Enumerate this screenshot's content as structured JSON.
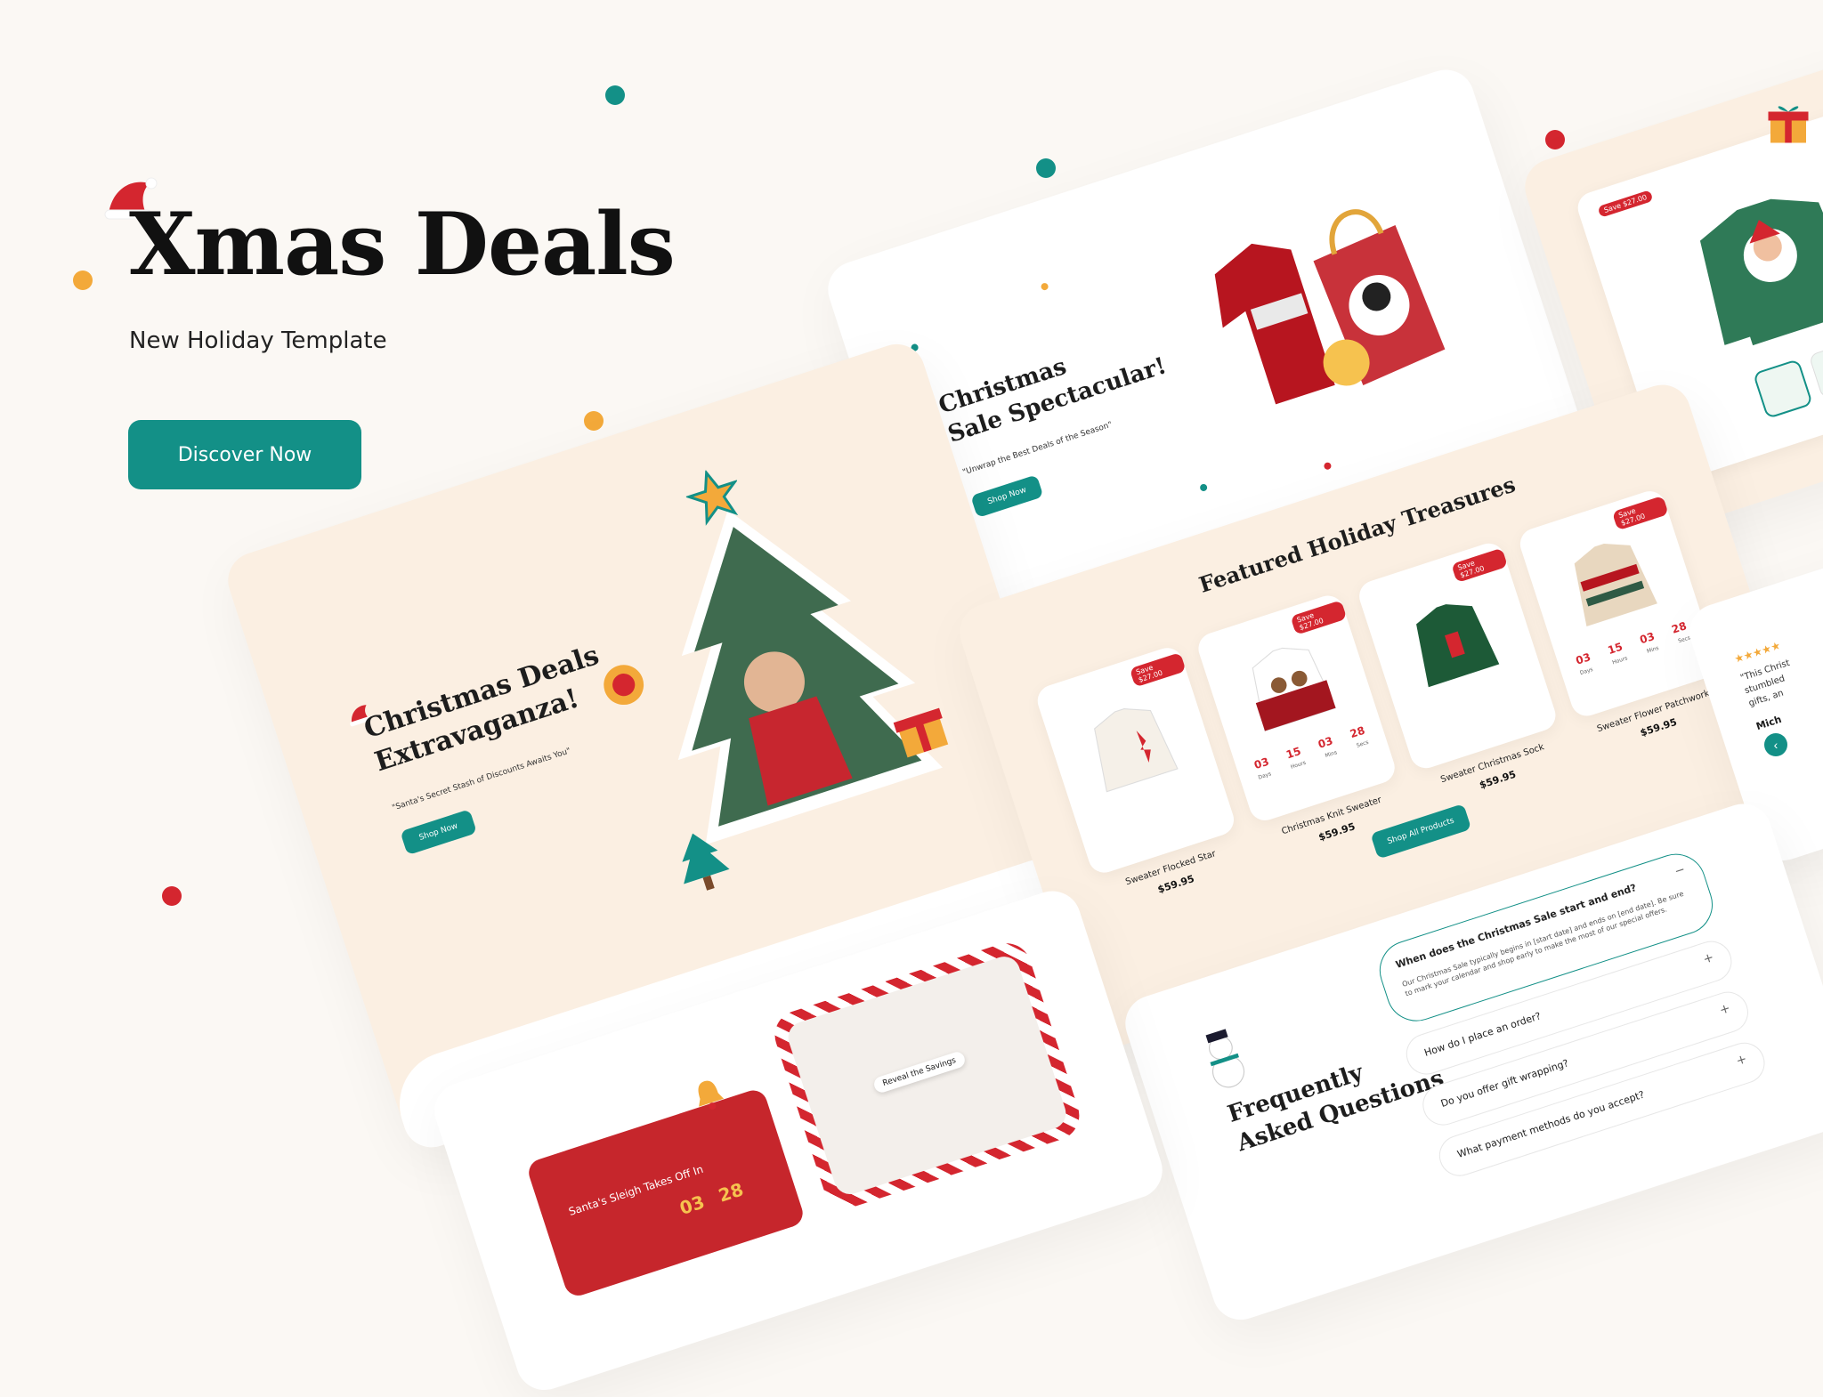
{
  "hero": {
    "title": "Xmas Deals",
    "subtitle": "New Holiday Template",
    "cta": "Discover Now"
  },
  "sale_panel": {
    "title_line1": "Christmas",
    "title_line2": "Sale Spectacular!",
    "tagline": "\"Unwrap the Best Deals of the Season\"",
    "button": "Shop Now"
  },
  "deals_panel": {
    "title_line1": "Christmas Deals",
    "title_line2": "Extravaganza!",
    "tagline": "\"Santa's Secret Stash of Discounts Awaits You\"",
    "button": "Shop Now"
  },
  "featured": {
    "title": "Featured Holiday Treasures",
    "button": "Shop All Products",
    "products": [
      {
        "name": "Sweater Flocked Star",
        "price": "$59.95",
        "badge": "Save $27.00"
      },
      {
        "name": "Christmas Knit Sweater",
        "price": "$59.95",
        "badge": "Save $27.00",
        "countdown": [
          "03",
          "15",
          "03",
          "28"
        ],
        "countdown_labels": [
          "Days",
          "Hours",
          "Mins",
          "Secs"
        ]
      },
      {
        "name": "Sweater Christmas Sock",
        "price": "$59.95",
        "badge": "Save $27.00"
      },
      {
        "name": "Sweater Flower Patchwork",
        "price": "$59.95",
        "badge": "Save $27.00",
        "countdown": [
          "03",
          "15",
          "03",
          "28"
        ],
        "countdown_labels": [
          "Days",
          "Hours",
          "Mins",
          "Secs"
        ]
      }
    ]
  },
  "product_detail": {
    "badge": "Save $27.00"
  },
  "review": {
    "stars": "★★★★★",
    "snippet_lines": [
      "\"This Christ",
      "stumbled",
      "gifts, an"
    ],
    "author": "Mich"
  },
  "faq": {
    "title_line1": "Frequently",
    "title_line2": "Asked Questions",
    "items": [
      {
        "q": "When does the Christmas Sale start and end?",
        "a": "Our Christmas Sale typically begins in [start date] and ends on [end date]. Be sure to mark your calendar and shop early to make the most of our special offers.",
        "icon": "−"
      },
      {
        "q": "How do I place an order?",
        "icon": "+"
      },
      {
        "q": "Do you offer gift wrapping?",
        "icon": "+"
      },
      {
        "q": "What payment methods do you accept?",
        "icon": "+"
      }
    ]
  },
  "reveal": {
    "label": "Reveal the Savings"
  },
  "countdown_panel": {
    "title": "Santa's Sleigh Takes Off In",
    "digits": [
      "03",
      "28"
    ]
  },
  "colors": {
    "teal": "#139087",
    "red": "#d4262f",
    "cream": "#fbefe2",
    "background": "#fbf8f4"
  }
}
